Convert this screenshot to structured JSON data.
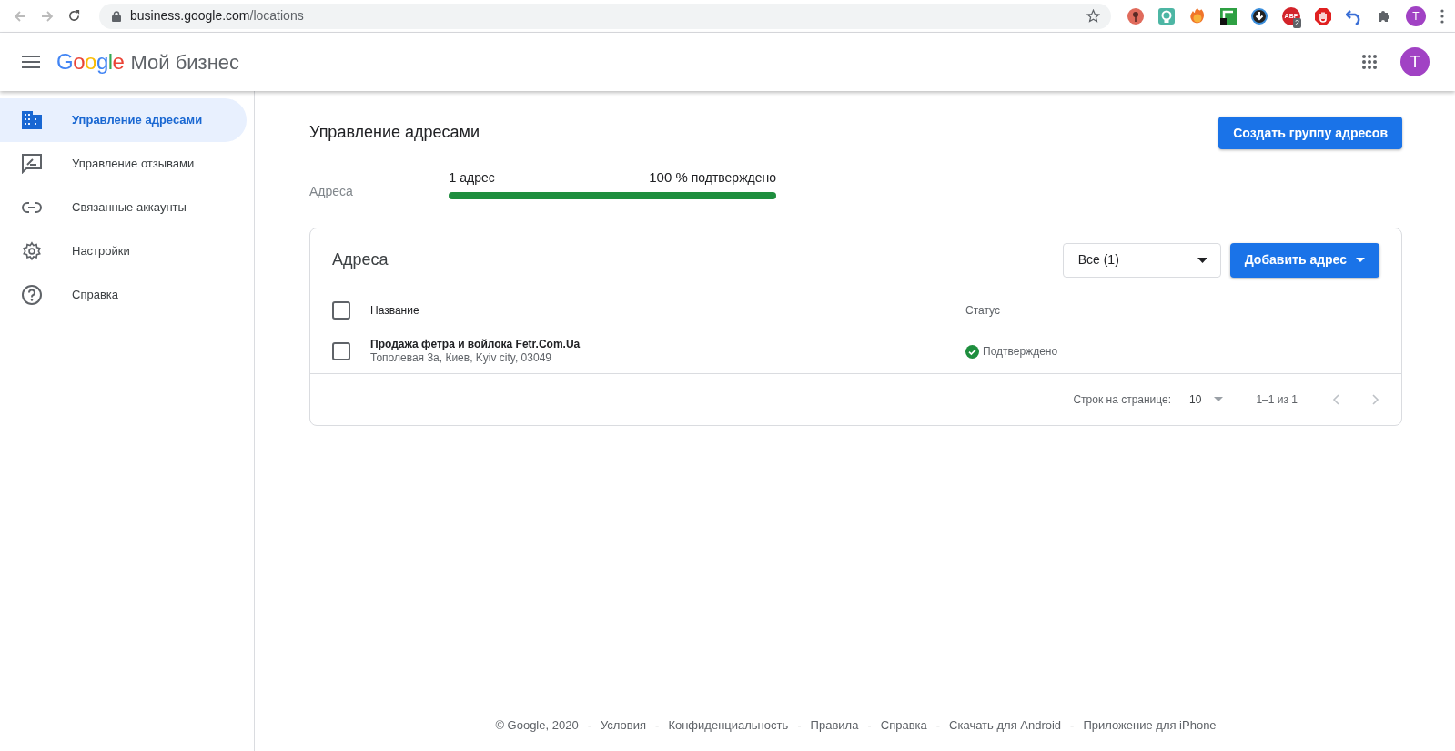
{
  "browser": {
    "url_host": "business.google.com",
    "url_path": "/locations",
    "extensions": [
      {
        "kind": "pin"
      },
      {
        "kind": "bulb"
      },
      {
        "kind": "fire"
      },
      {
        "kind": "square"
      },
      {
        "kind": "download"
      },
      {
        "kind": "abp",
        "text": "ABP",
        "badge": "2"
      },
      {
        "kind": "hand"
      },
      {
        "kind": "undo"
      },
      {
        "kind": "puzzle"
      }
    ],
    "profile": "T"
  },
  "header": {
    "logo": "Google",
    "product": "Мой бизнес",
    "avatar": "T"
  },
  "sidebar": {
    "items": [
      {
        "kind": "building",
        "label": "Управление адресами",
        "selected": true
      },
      {
        "kind": "review",
        "label": "Управление отзывами",
        "selected": false
      },
      {
        "kind": "link",
        "label": "Связанные аккаунты",
        "selected": false
      },
      {
        "kind": "gear",
        "label": "Настройки",
        "selected": false
      },
      {
        "kind": "help",
        "label": "Справка",
        "selected": false
      }
    ]
  },
  "page": {
    "title": "Управление адресами",
    "create_button": "Создать группу адресов",
    "summary": {
      "label": "Адреса",
      "count": "1",
      "count_unit": "адрес",
      "percent": "100 %",
      "percent_text": "подтверждено",
      "level": 1.0
    }
  },
  "card": {
    "title": "Адреса",
    "filter": "Все (1)",
    "add_button": "Добавить адрес",
    "columns": [
      "Название",
      "Статус"
    ],
    "header_checked": false,
    "rows": [
      {
        "checked": false,
        "name": "Продажа фетра и войлока Fetr.Com.Ua",
        "address": "Тополевая 3а, Киев, Kyiv city, 03049",
        "status": "Подтверждено",
        "verified": true
      }
    ],
    "pagination": {
      "rows_label": "Строк на странице:",
      "rows_value": "10",
      "range": "1–1 из 1"
    }
  },
  "footer": {
    "copyright": "© Google, 2020",
    "links": [
      {
        "separator": "-",
        "text": "Условия"
      },
      {
        "separator": "-",
        "text": "Конфиденциальность"
      },
      {
        "separator": "-",
        "text": "Правила"
      },
      {
        "separator": "-",
        "text": "Справка"
      },
      {
        "separator": "-",
        "text": "Скачать для Android"
      },
      {
        "separator": "-",
        "text": "Приложение для iPhone"
      }
    ]
  }
}
